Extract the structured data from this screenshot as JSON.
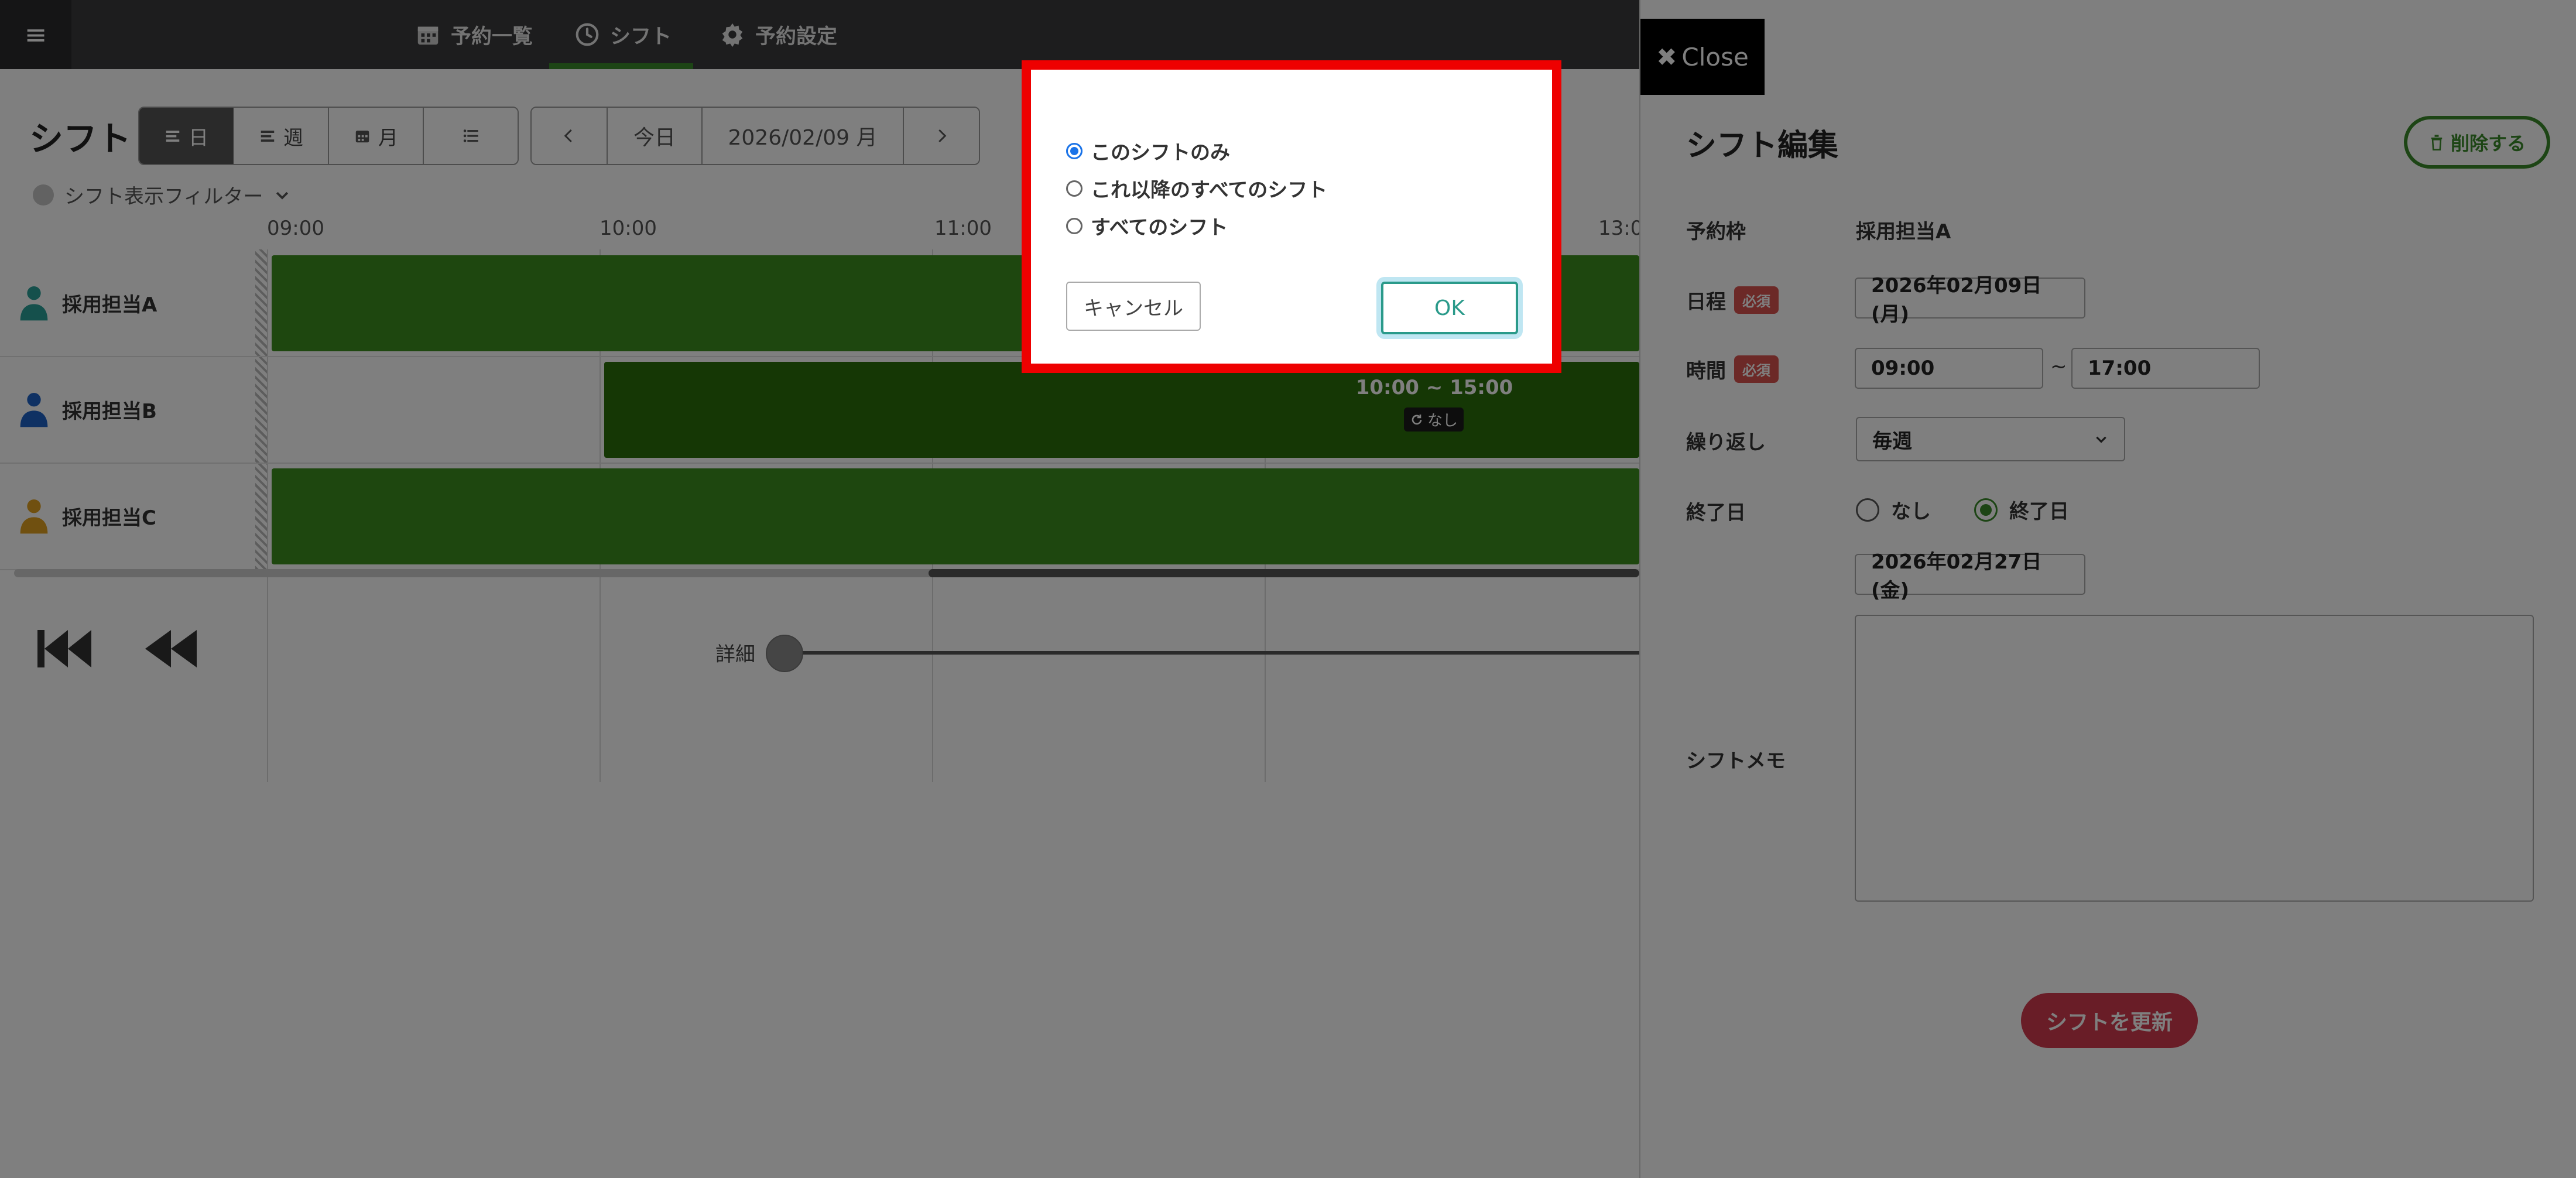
{
  "nav": {
    "items": [
      {
        "label": "予約一覧",
        "icon": "calendar-icon"
      },
      {
        "label": "シフト",
        "icon": "clock-icon"
      },
      {
        "label": "予約設定",
        "icon": "gear-icon"
      }
    ]
  },
  "calendar": {
    "title": "シフト",
    "views": [
      {
        "label": "日",
        "icon": "list-icon",
        "active": true
      },
      {
        "label": "週",
        "icon": "list-icon"
      },
      {
        "label": "月",
        "icon": "calendar-icon"
      },
      {
        "label": "",
        "icon": "list-detail-icon"
      }
    ],
    "today_label": "今日",
    "date_label": "2026/02/09 月",
    "filter_label": "シフト表示フィルター"
  },
  "timeline": {
    "ticks": [
      "09:00",
      "10:00",
      "11:00",
      "13:0"
    ],
    "rows": [
      {
        "name": "採用担当A",
        "icon": "person-icon",
        "icon_color": "#2aa198"
      },
      {
        "name": "採用担当B",
        "icon": "person-icon",
        "icon_color": "#1e63c6"
      },
      {
        "name": "採用担当C",
        "icon": "person-icon",
        "icon_color": "#e0a020"
      }
    ],
    "shift_b": {
      "time": "10:00 ~ 15:00",
      "repeat": "なし"
    }
  },
  "zoom": {
    "label": "詳細"
  },
  "panel": {
    "close_label": "Close",
    "title": "シフト編集",
    "delete_label": "削除する",
    "required_label": "必須",
    "labels": {
      "slot": "予約枠",
      "date": "日程",
      "time": "時間",
      "repeat": "繰り返し",
      "end_date": "終了日",
      "memo": "シフトメモ"
    },
    "slot_value": "採用担当A",
    "date_value": "2026年02月09日(月)",
    "time_start": "09:00",
    "time_sep": "~",
    "time_end": "17:00",
    "repeat_value": "毎週",
    "end_options": {
      "none": "なし",
      "end": "終了日"
    },
    "end_date_value": "2026年02月27日(金)",
    "update_label": "シフトを更新"
  },
  "modal": {
    "options": [
      "このシフトのみ",
      "これ以降のすべてのシフト",
      "すべてのシフト"
    ],
    "selected_index": 0,
    "cancel_label": "キャンセル",
    "ok_label": "OK"
  }
}
